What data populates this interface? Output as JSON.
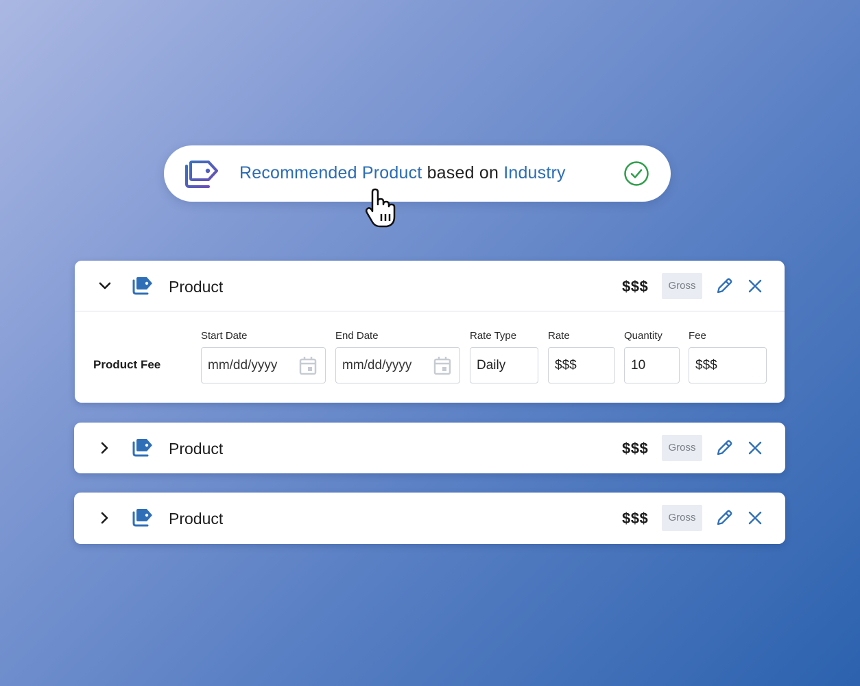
{
  "recommendation": {
    "text_part1": "Recommended Product",
    "text_part2": " based on ",
    "text_part3": "Industry",
    "icon": "tag-stack-icon",
    "status_icon": "check-circle-icon",
    "accent_color": "#2b6cb5",
    "check_color": "#2e9e4a"
  },
  "products": [
    {
      "name": "Product",
      "price": "$$$",
      "badge": "Gross",
      "expanded": true,
      "fee_row": {
        "label": "Product Fee",
        "fields": {
          "start_date": {
            "label": "Start Date",
            "placeholder": "mm/dd/yyyy"
          },
          "end_date": {
            "label": "End Date",
            "placeholder": "mm/dd/yyyy"
          },
          "rate_type": {
            "label": "Rate Type",
            "value": "Daily"
          },
          "rate": {
            "label": "Rate",
            "value": "$$$"
          },
          "quantity": {
            "label": "Quantity",
            "value": "10"
          },
          "fee": {
            "label": "Fee",
            "value": "$$$"
          }
        }
      }
    },
    {
      "name": "Product",
      "price": "$$$",
      "badge": "Gross",
      "expanded": false
    },
    {
      "name": "Product",
      "price": "$$$",
      "badge": "Gross",
      "expanded": false
    }
  ],
  "colors": {
    "brand_blue": "#2b6cb5",
    "icon_blue": "#2f6fb8"
  }
}
